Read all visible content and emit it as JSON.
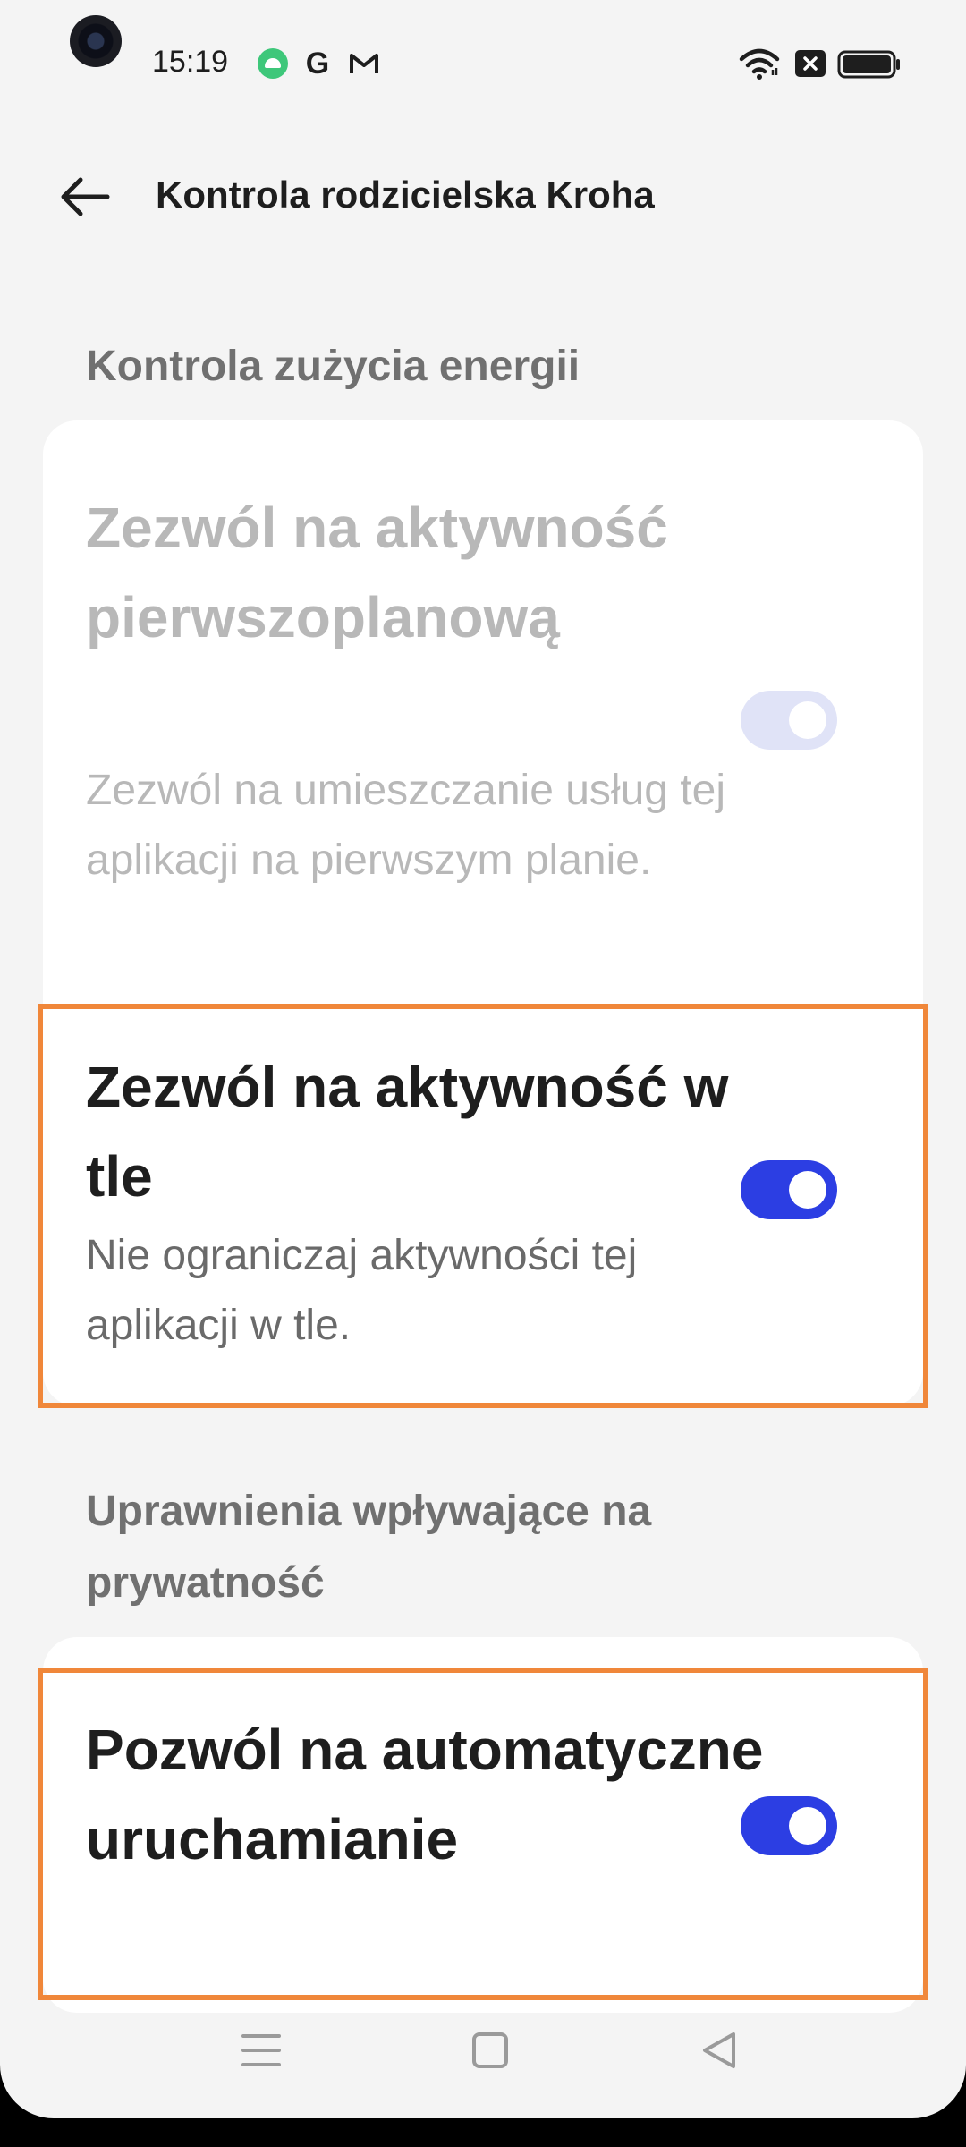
{
  "status_bar": {
    "time": "15:19",
    "icons": [
      "android-notification-icon",
      "google-icon",
      "gmail-icon",
      "wifi-icon",
      "sim-no-signal-icon",
      "battery-icon"
    ],
    "google_glyph": "G"
  },
  "header": {
    "back_icon": "arrow-left-icon",
    "title": "Kontrola rodzicielska Kroha"
  },
  "sections": {
    "energy_title": "Kontrola zużycia energii",
    "privacy_title": "Uprawnienia wpływające na prywatność"
  },
  "settings": {
    "foreground": {
      "title": "Zezwól na aktywność pierwszoplanową",
      "description": "Zezwól na umieszczanie usług tej aplikacji na pierwszym planie.",
      "enabled": true,
      "disabled_appearance": true
    },
    "background": {
      "title": "Zezwól na aktywność w tle",
      "description": "Nie ograniczaj aktywności tej aplikacji w tle.",
      "enabled": true
    },
    "autostart": {
      "title": "Pozwól na automatyczne uruchamianie",
      "enabled": true
    }
  },
  "navigation_bar": {
    "items": [
      "menu-icon",
      "home-square-icon",
      "back-triangle-icon"
    ]
  },
  "colors": {
    "toggle_on": "#2c3ee3",
    "toggle_disabled": "#e0e3f7",
    "highlight": "#f0873a",
    "background": "#f4f4f4",
    "card": "#ffffff"
  }
}
